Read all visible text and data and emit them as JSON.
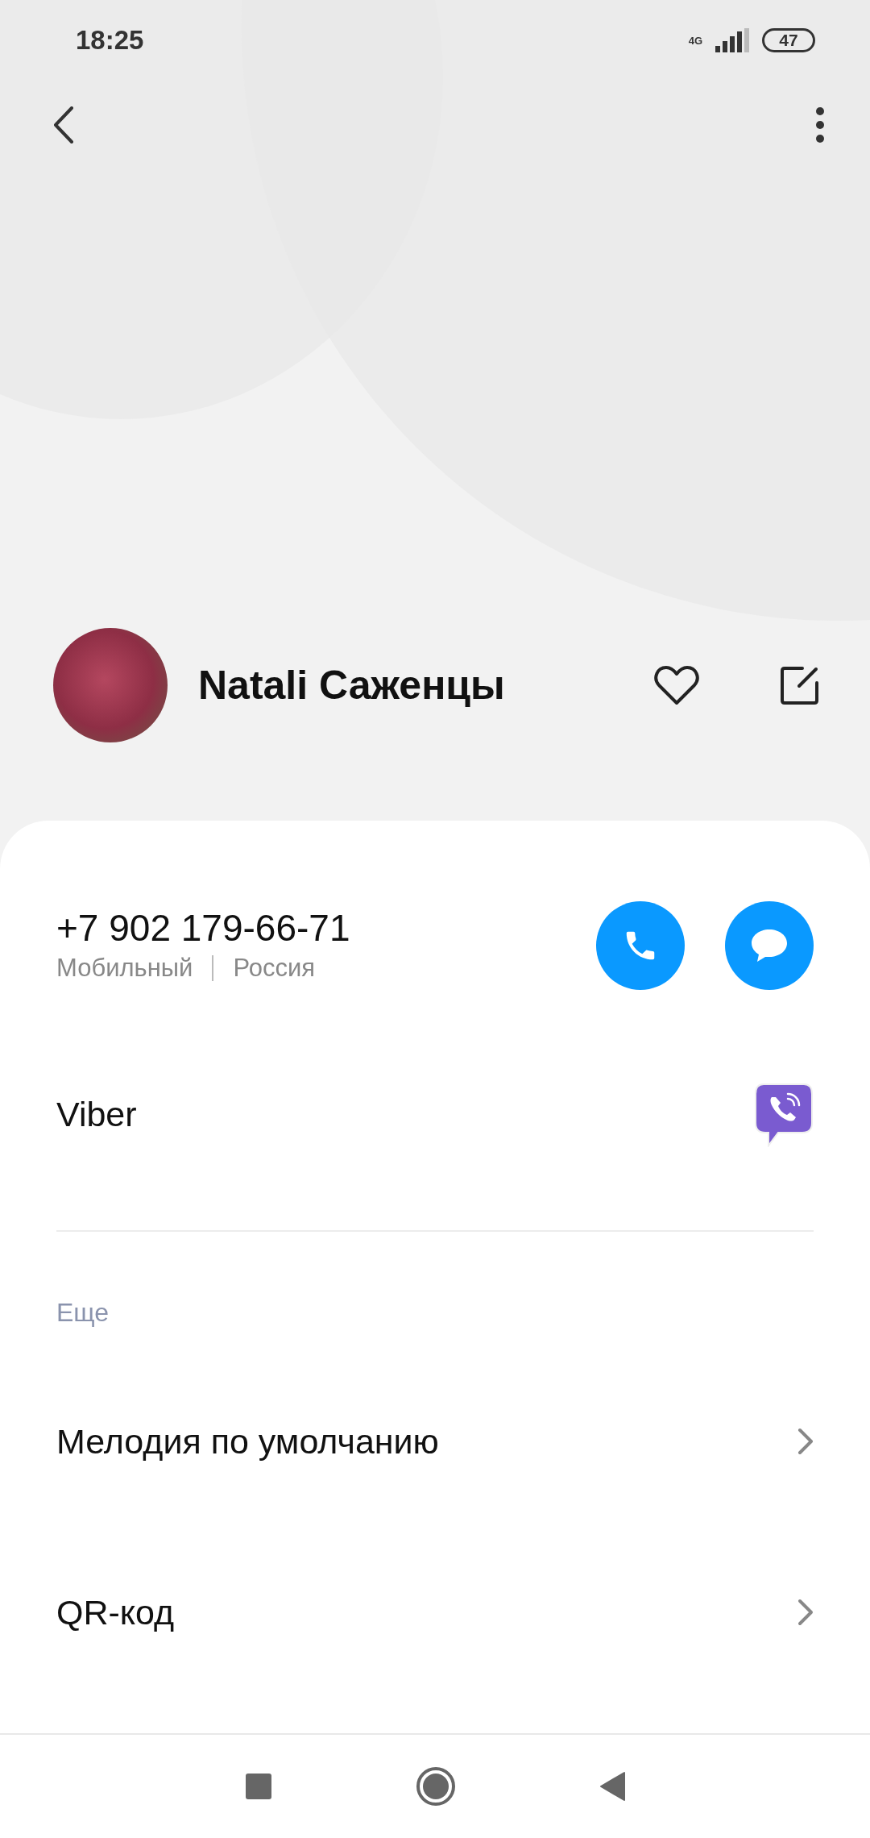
{
  "status_bar": {
    "time": "18:25",
    "network": "4G",
    "battery": "47"
  },
  "header": {
    "name": "Natali Саженцы"
  },
  "phone": {
    "number": "+7 902 179-66-71",
    "type": "Мобильный",
    "region": "Россия"
  },
  "apps": [
    {
      "label": "Viber"
    }
  ],
  "section_title": "Еще",
  "menu": [
    {
      "label": "Мелодия по умолчанию"
    },
    {
      "label": "QR-код"
    }
  ]
}
